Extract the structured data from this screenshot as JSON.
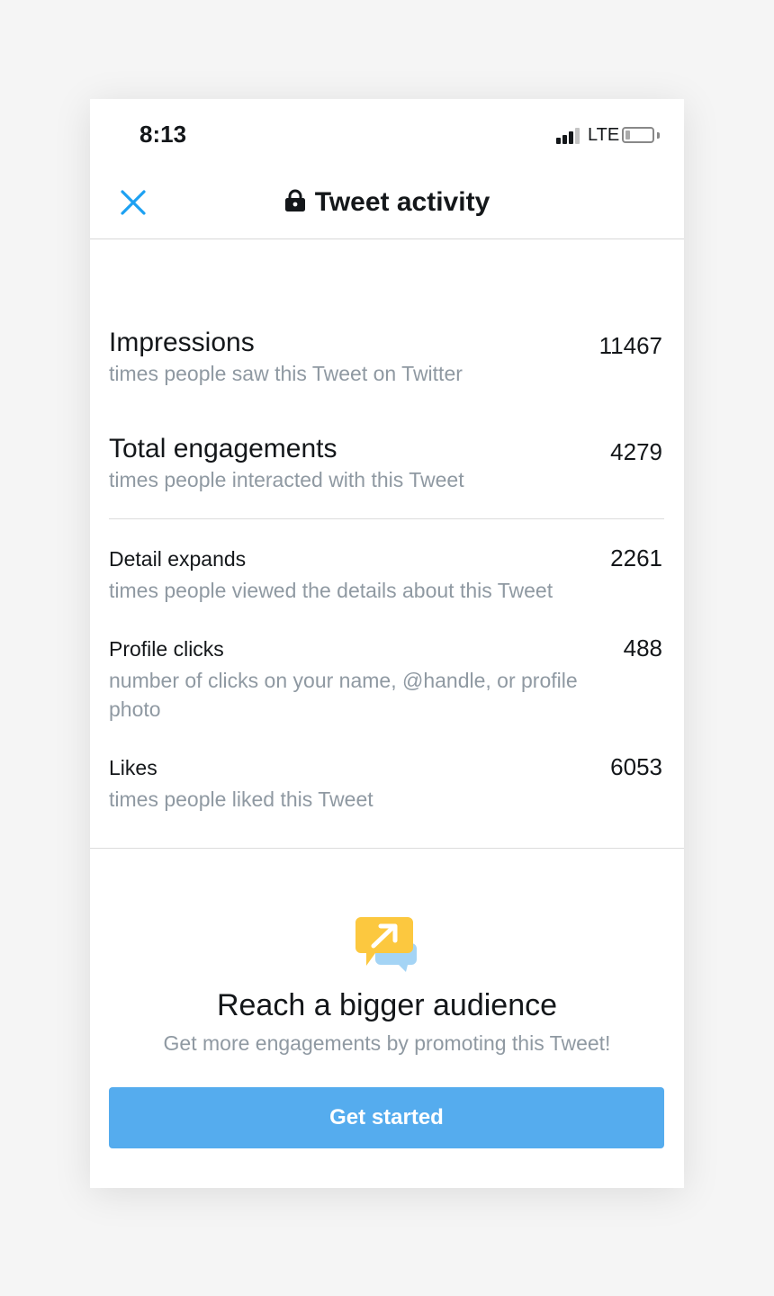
{
  "status_bar": {
    "time": "8:13",
    "network": "LTE"
  },
  "nav": {
    "title": "Tweet activity"
  },
  "metrics": [
    {
      "label": "Impressions",
      "value": "11467",
      "description": "times people saw this Tweet on Twitter"
    },
    {
      "label": "Total engagements",
      "value": "4279",
      "description": "times people interacted with this Tweet"
    },
    {
      "label": "Detail expands",
      "value": "2261",
      "description": "times people viewed the details about this Tweet"
    },
    {
      "label": "Profile clicks",
      "value": "488",
      "description": "number of clicks on your name, @handle, or profile photo"
    },
    {
      "label": "Likes",
      "value": "6053",
      "description": "times people liked this Tweet"
    }
  ],
  "promo": {
    "icon": "promote-chat-icon",
    "title": "Reach a bigger audience",
    "subtitle": "Get more engagements by promoting this Tweet!",
    "button_label": "Get started"
  },
  "colors": {
    "accent": "#1da1f2",
    "button": "#55acee",
    "muted_text": "#8f99a2",
    "promo_yellow": "#fcc83f",
    "promo_blue": "#a4d4f5"
  }
}
